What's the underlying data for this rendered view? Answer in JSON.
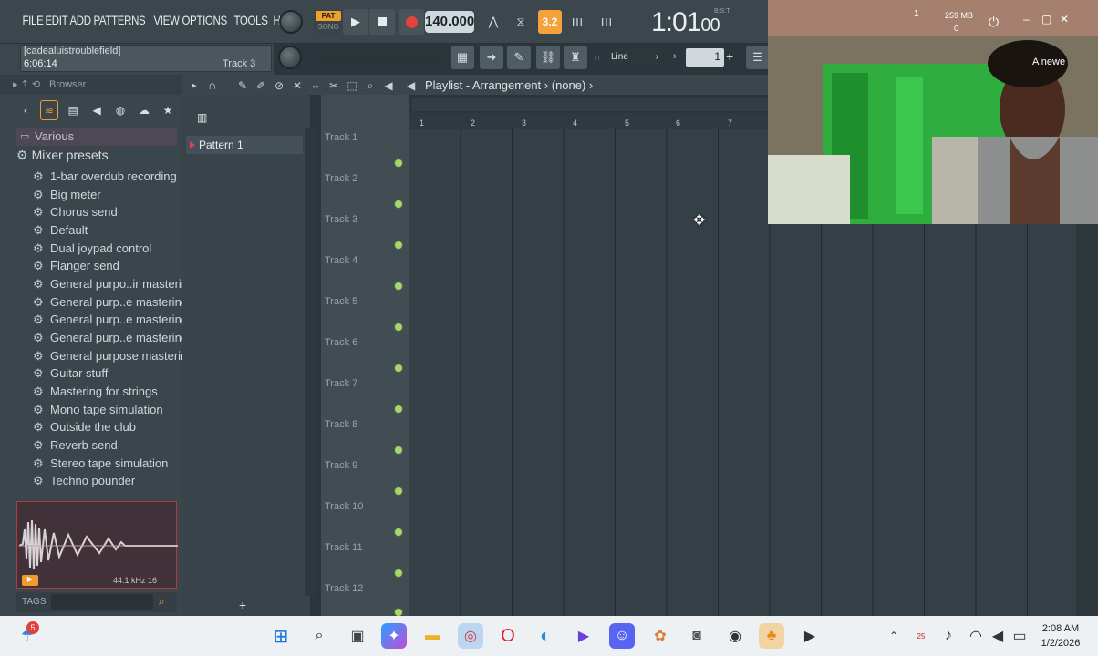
{
  "menu": [
    "FILE",
    "EDIT",
    "ADD",
    "PATTERNS",
    "VIEW",
    "OPTIONS",
    "TOOLS",
    "HELP"
  ],
  "hint": {
    "line1": "[cadealuistroublefield]",
    "line2": "6:06:14",
    "track": "Track 3"
  },
  "transport": {
    "pat": "PAT",
    "song": "SONG",
    "tempo": "140.000",
    "time_main": "1:01",
    "time_sub": "00",
    "time_label": "B:S:T"
  },
  "snap": {
    "mode": "Line",
    "step": "1"
  },
  "browser": {
    "title": "Browser",
    "category": "Various",
    "folder": "Mixer presets",
    "presets": [
      "1-bar overdub recording",
      "Big meter",
      "Chorus send",
      "Default",
      "Dual joypad control",
      "Flanger send",
      "General purpo..ir mastering",
      "General purp..e mastering 2",
      "General purp..e mastering 3",
      "General purp..e mastering 4",
      "General purpose mastering",
      "Guitar stuff",
      "Mastering for strings",
      "Mono tape simulation",
      "Outside the club",
      "Reverb send",
      "Stereo tape simulation",
      "Techno pounder"
    ],
    "wave_info": "44.1 kHz 16",
    "tags": "TAGS"
  },
  "playlist": {
    "title": "Playlist - Arrangement",
    "pattern_sel": "(none)",
    "pattern": "Pattern 1",
    "tracks": [
      "Track 1",
      "Track 2",
      "Track 3",
      "Track 4",
      "Track 5",
      "Track 6",
      "Track 7",
      "Track 8",
      "Track 9",
      "Track 10",
      "Track 11",
      "Track 12"
    ],
    "bars": [
      "1",
      "2",
      "3",
      "4",
      "5",
      "6",
      "7"
    ]
  },
  "overlay": {
    "mem": "259 MB",
    "num1": "1",
    "num2": "0",
    "notice": "A newe"
  },
  "taskbar": {
    "time": "2:08 AM",
    "date": "1/2/2026",
    "badge": "5",
    "badge2": "25"
  }
}
